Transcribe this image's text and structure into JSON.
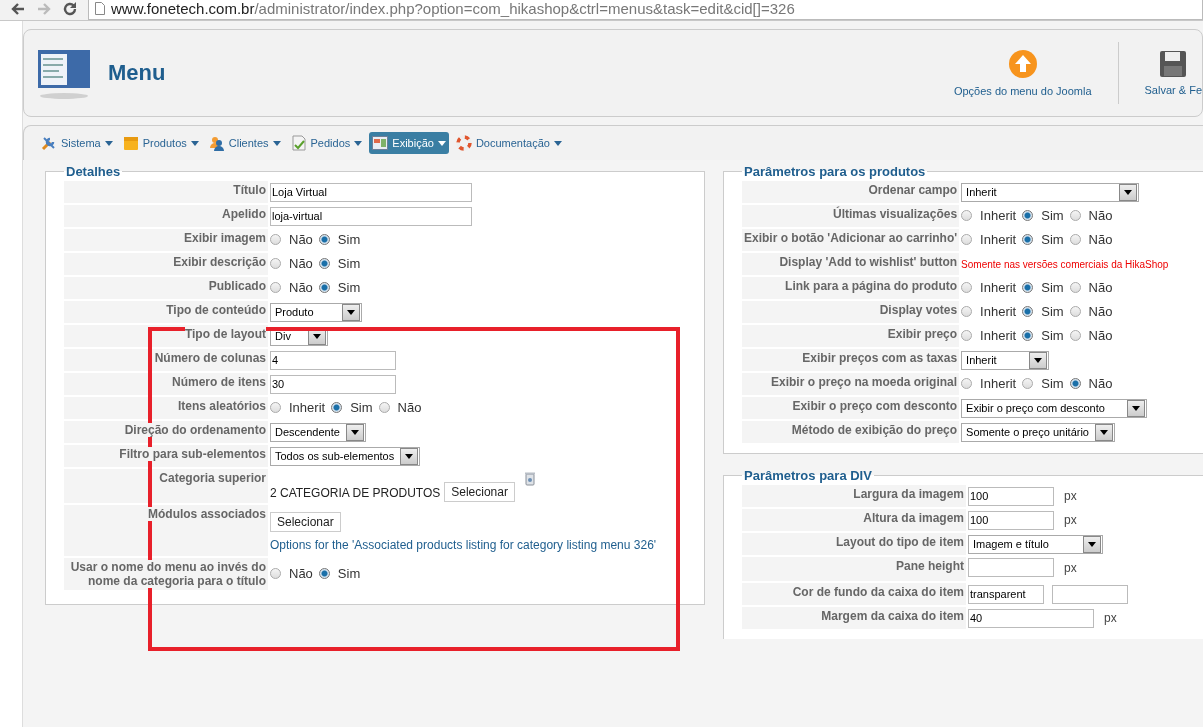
{
  "browser": {
    "url_host": "www.fonetech.com.br",
    "url_path": "/administrator/index.php?option=com_hikashop&ctrl=menus&task=edit&cid[]=326",
    "forward_disabled": true
  },
  "header": {
    "title": "Menu",
    "toolbar": [
      {
        "kind": "options",
        "label": "Opções do menu do Joomla"
      },
      {
        "kind": "save",
        "label": "Salvar & Fe"
      }
    ]
  },
  "menu": [
    {
      "kind": "system",
      "label": "Sistema",
      "selected": false
    },
    {
      "kind": "products",
      "label": "Produtos",
      "selected": false
    },
    {
      "kind": "customers",
      "label": "Clientes",
      "selected": false
    },
    {
      "kind": "orders",
      "label": "Pedidos",
      "selected": false
    },
    {
      "kind": "display",
      "label": "Exibição",
      "selected": true
    },
    {
      "kind": "help",
      "label": "Documentação",
      "selected": false
    }
  ],
  "details": {
    "legend": "Detalhes",
    "rows": [
      {
        "label": "Título",
        "kind": "text",
        "value": "Loja Virtual"
      },
      {
        "label": "Apelido",
        "kind": "text",
        "value": "loja-virtual"
      },
      {
        "label": "Exibir imagem",
        "kind": "radio",
        "options": [
          {
            "label": "Não",
            "selected": false
          },
          {
            "label": "Sim",
            "selected": true
          }
        ]
      },
      {
        "label": "Exibir descrição",
        "kind": "radio",
        "options": [
          {
            "label": "Não",
            "selected": false
          },
          {
            "label": "Sim",
            "selected": true
          }
        ]
      },
      {
        "label": "Publicado",
        "kind": "radio",
        "options": [
          {
            "label": "Não",
            "selected": false
          },
          {
            "label": "Sim",
            "selected": true
          }
        ]
      },
      {
        "label": "Tipo de conteúdo",
        "kind": "select",
        "value": "Produto"
      },
      {
        "label": "Tipo de layout",
        "kind": "select",
        "value": "Div"
      },
      {
        "label": "Número de colunas",
        "kind": "short",
        "value": "4"
      },
      {
        "label": "Número de itens",
        "kind": "short",
        "value": "30"
      },
      {
        "label": "Itens aleatórios",
        "kind": "radio",
        "options": [
          {
            "label": "Inherit",
            "selected": false
          },
          {
            "label": "Sim",
            "selected": true
          },
          {
            "label": "Não",
            "selected": false
          }
        ]
      },
      {
        "label": "Direção do ordenamento",
        "kind": "select",
        "value": "Descendente"
      },
      {
        "label": "Filtro para sub-elementos",
        "kind": "select",
        "value": "Todos os sub-elementos"
      },
      {
        "label": "Categoria superior",
        "kind": "category",
        "value": "2 CATEGORIA DE PRODUTOS",
        "button": "Selecionar"
      },
      {
        "label": "Módulos associados",
        "kind": "modules",
        "button": "Selecionar",
        "link": "Options for the 'Associated products listing for category listing menu 326'"
      },
      {
        "label": "Usar o nome do menu ao invés do nome da categoria para o título",
        "kind": "radio",
        "options": [
          {
            "label": "Não",
            "selected": false
          },
          {
            "label": "Sim",
            "selected": true
          }
        ]
      }
    ]
  },
  "products": {
    "legend": "Parâmetros para os produtos",
    "rows": [
      {
        "label": "Ordenar campo",
        "kind": "select",
        "value": "Inherit"
      },
      {
        "label": "Últimas visualizações",
        "kind": "radio",
        "options": [
          {
            "label": "Inherit",
            "selected": false
          },
          {
            "label": "Sim",
            "selected": true
          },
          {
            "label": "Não",
            "selected": false
          }
        ]
      },
      {
        "label": "Exibir o botão 'Adicionar ao carrinho'",
        "kind": "radio",
        "options": [
          {
            "label": "Inherit",
            "selected": false
          },
          {
            "label": "Sim",
            "selected": true
          },
          {
            "label": "Não",
            "selected": false
          }
        ]
      },
      {
        "label": "Display 'Add to wishlist' button",
        "kind": "note",
        "value": "Somente nas versões comerciais da HikaShop"
      },
      {
        "label": "Link para a página do produto",
        "kind": "radio",
        "options": [
          {
            "label": "Inherit",
            "selected": false
          },
          {
            "label": "Sim",
            "selected": true
          },
          {
            "label": "Não",
            "selected": false
          }
        ]
      },
      {
        "label": "Display votes",
        "kind": "radio",
        "options": [
          {
            "label": "Inherit",
            "selected": false
          },
          {
            "label": "Sim",
            "selected": true
          },
          {
            "label": "Não",
            "selected": false
          }
        ]
      },
      {
        "label": "Exibir preço",
        "kind": "radio",
        "options": [
          {
            "label": "Inherit",
            "selected": false
          },
          {
            "label": "Sim",
            "selected": true
          },
          {
            "label": "Não",
            "selected": false
          }
        ]
      },
      {
        "label": "Exibir preços com as taxas",
        "kind": "select",
        "value": "Inherit"
      },
      {
        "label": "Exibir o preço na moeda original",
        "kind": "radio",
        "options": [
          {
            "label": "Inherit",
            "selected": false
          },
          {
            "label": "Sim",
            "selected": false
          },
          {
            "label": "Não",
            "selected": true
          }
        ]
      },
      {
        "label": "Exibir o preço com desconto",
        "kind": "select",
        "value": "Exibir o preço com desconto"
      },
      {
        "label": "Método de exibição do preço",
        "kind": "select",
        "value": "Somente o preço unitário"
      }
    ]
  },
  "div_params": {
    "legend": "Parâmetros para DIV",
    "rows": [
      {
        "label": "Largura da imagem",
        "kind": "px",
        "value": "100",
        "unit": "px"
      },
      {
        "label": "Altura da imagem",
        "kind": "px",
        "value": "100",
        "unit": "px"
      },
      {
        "label": "Layout do tipo de item",
        "kind": "select",
        "value": "Imagem e título"
      },
      {
        "label": "Pane height",
        "kind": "px",
        "unit": "px"
      },
      {
        "label": "Cor de fundo da caixa do item",
        "kind": "color",
        "value": "transparent"
      },
      {
        "label": "Margem da caixa do item",
        "kind": "wide_px",
        "value": "40",
        "unit": "px"
      }
    ]
  },
  "annotation": {
    "kind": "highlight-frame"
  }
}
